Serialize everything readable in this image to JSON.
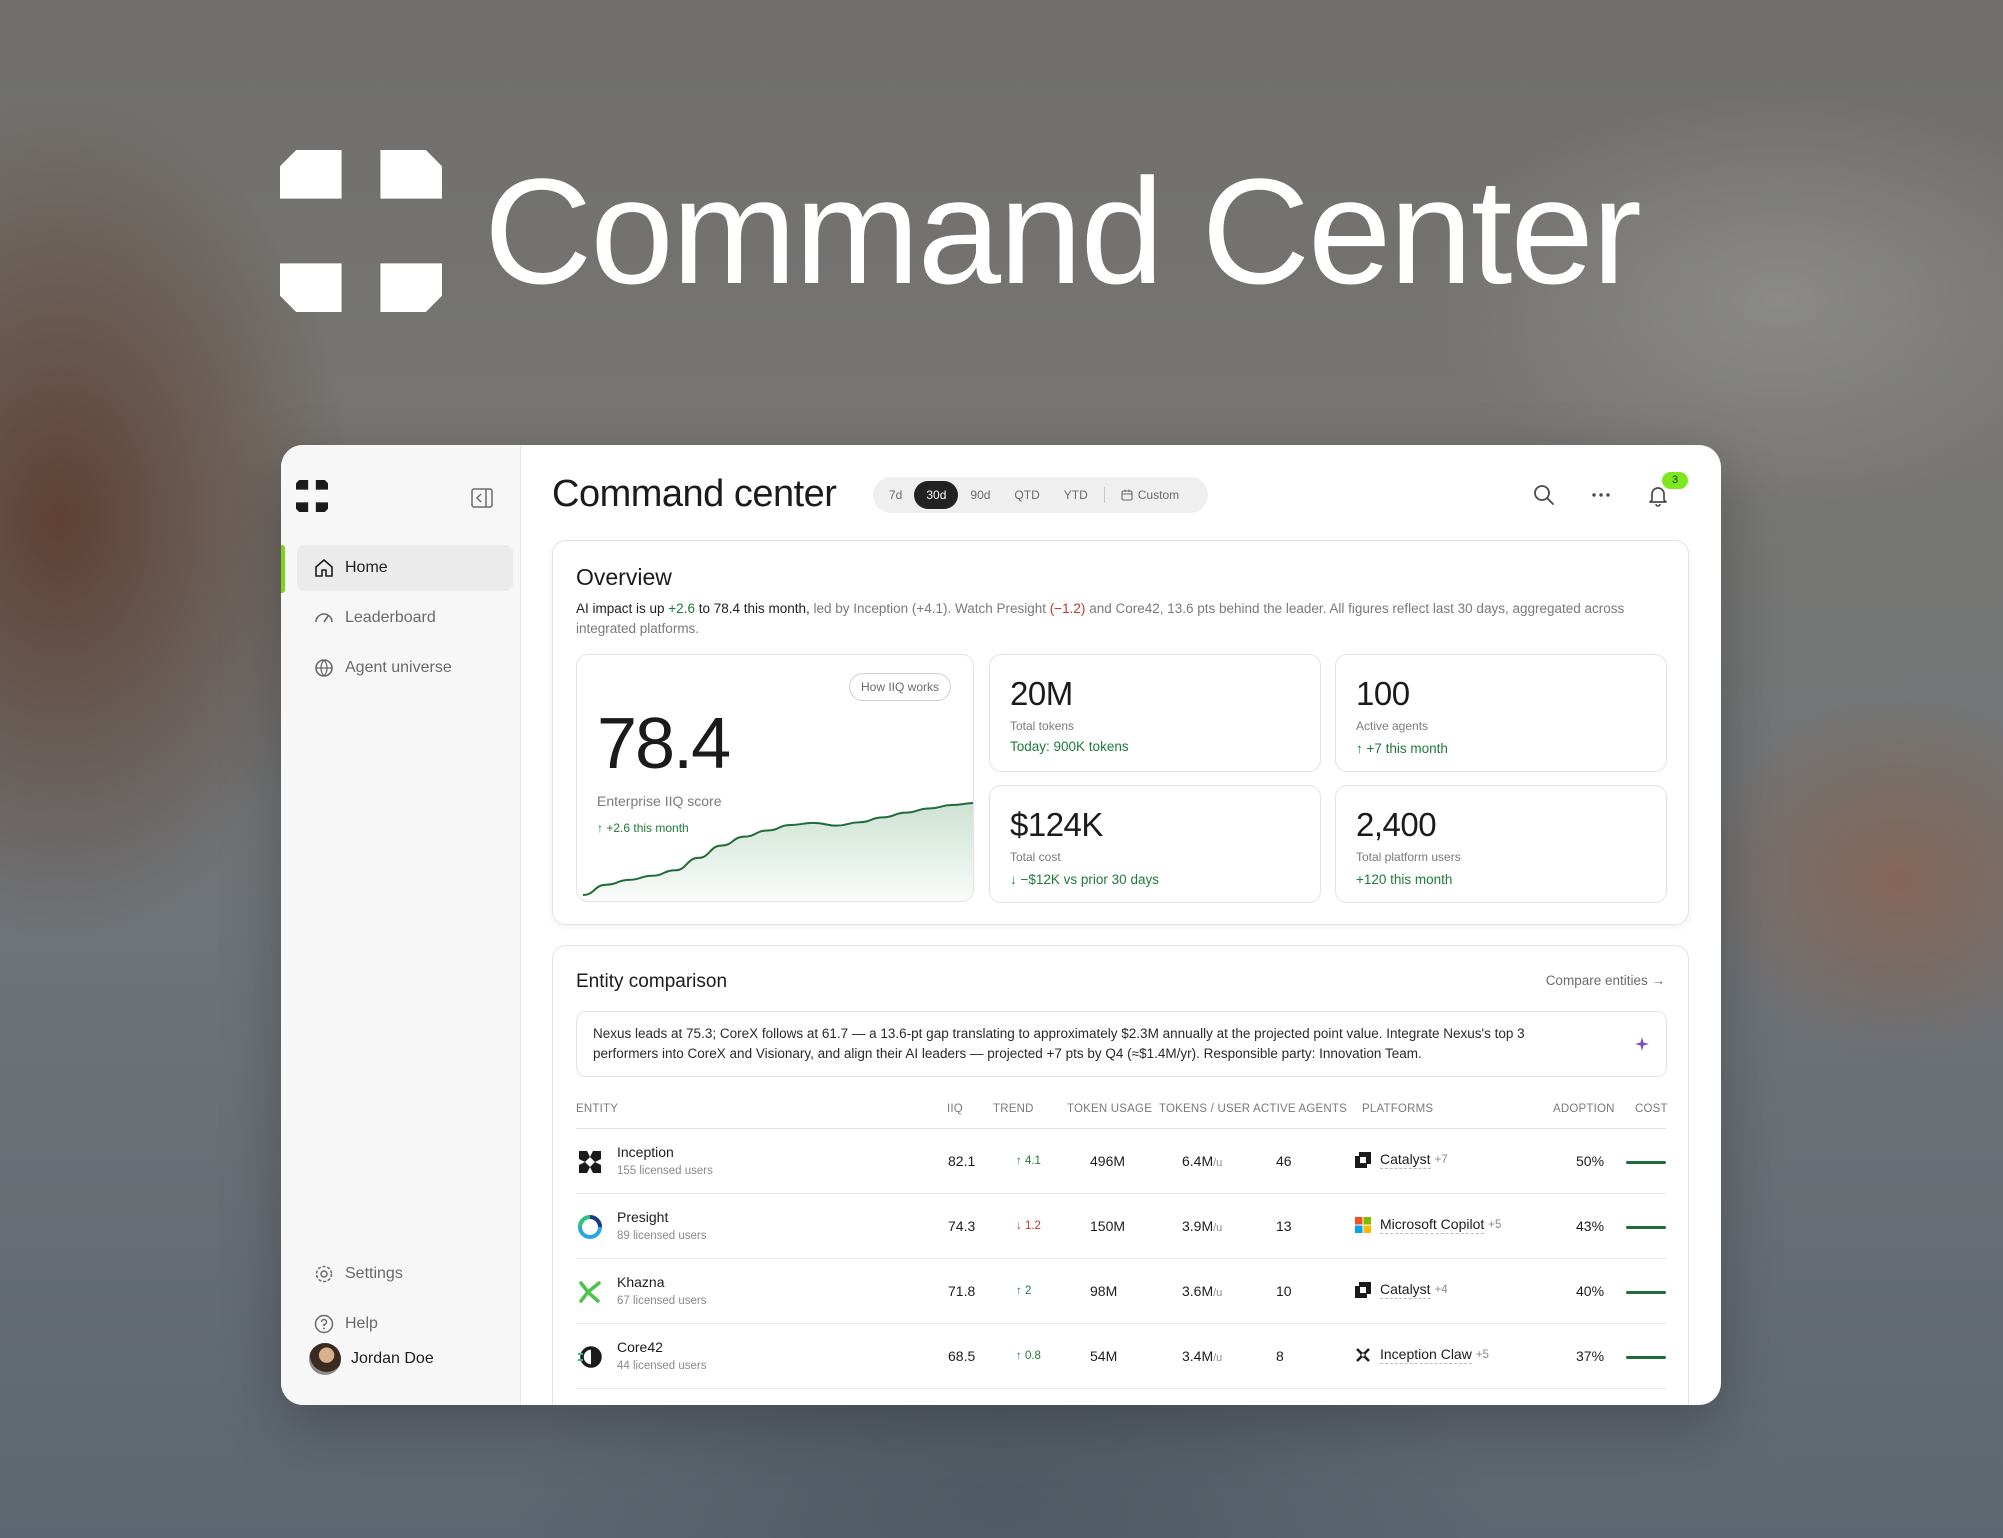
{
  "hero": {
    "title": "Command Center"
  },
  "sidebar": {
    "items": [
      {
        "label": "Home",
        "icon": "home-icon",
        "active": true
      },
      {
        "label": "Leaderboard",
        "icon": "gauge-icon",
        "active": false
      },
      {
        "label": "Agent universe",
        "icon": "globe-icon",
        "active": false
      }
    ],
    "bottom": [
      {
        "label": "Settings",
        "icon": "gear-icon"
      },
      {
        "label": "Help",
        "icon": "help-icon"
      }
    ],
    "user": {
      "name": "Jordan Doe"
    }
  },
  "header": {
    "title": "Command center",
    "ranges": [
      "7d",
      "30d",
      "90d",
      "QTD",
      "YTD"
    ],
    "selected_range": "30d",
    "custom_label": "Custom",
    "notifications": "3"
  },
  "overview": {
    "title": "Overview",
    "summary": {
      "p1": "AI impact is up ",
      "up": "+2.6",
      "p2": " to 78.4 this month,",
      "p3": " led by Inception (+4.1). Watch Presight ",
      "down": "(−1.2)",
      "p4": " and Core42, 13.6 pts behind the leader. All figures reflect last 30 days, aggregated across integrated platforms."
    },
    "score": {
      "button": "How IIQ works",
      "value": "78.4",
      "label": "Enterprise IIQ score",
      "delta": "↑ +2.6 this month",
      "trend": [
        65,
        66.5,
        67.2,
        67.8,
        68.6,
        70.4,
        72.2,
        73.5,
        74.4,
        75.2,
        75.5,
        75.1,
        75.6,
        76.3,
        77.0,
        77.6,
        78.1,
        78.4
      ]
    },
    "stats": [
      {
        "value": "20M",
        "label": "Total tokens",
        "sub": "Today: 900K tokens"
      },
      {
        "value": "100",
        "label": "Active agents",
        "sub": "↑ +7 this month"
      },
      {
        "value": "$124K",
        "label": "Total cost",
        "sub": "↓ −$12K vs prior 30 days"
      },
      {
        "value": "2,400",
        "label": "Total platform users",
        "sub": "+120 this month"
      }
    ]
  },
  "entity": {
    "title": "Entity comparison",
    "link": "Compare entities →",
    "insight": "Nexus leads at 75.3; CoreX follows at 61.7 — a 13.6-pt gap translating to approximately $2.3M annually at the projected point value. Integrate Nexus's top 3 performers into CoreX and Visionary, and align their AI leaders — projected +7 pts by Q4 (≈$1.4M/yr). Responsible party: Innovation Team.",
    "columns": [
      "ENTITY",
      "IIQ",
      "TREND",
      "TOKEN USAGE",
      "TOKENS / USER",
      "ACTIVE AGENTS",
      "PLATFORMS",
      "ADOPTION",
      "COST"
    ],
    "unit": "/u",
    "rows": [
      {
        "name": "Inception",
        "sub": "155 licensed users",
        "iiq": "82.1",
        "trend": "↑ 4.1",
        "tokens": "496M",
        "per_user": "6.4M",
        "agents": "46",
        "platform": "Catalyst",
        "more": "+7",
        "adoption": "50%"
      },
      {
        "name": "Presight",
        "sub": "89 licensed users",
        "iiq": "74.3",
        "trend": "↓ 1.2",
        "tokens": "150M",
        "per_user": "3.9M",
        "agents": "13",
        "platform": "Microsoft Copilot",
        "more": "+5",
        "adoption": "43%"
      },
      {
        "name": "Khazna",
        "sub": "67 licensed users",
        "iiq": "71.8",
        "trend": "↑ 2",
        "tokens": "98M",
        "per_user": "3.6M",
        "agents": "10",
        "platform": "Catalyst",
        "more": "+4",
        "adoption": "40%"
      },
      {
        "name": "Core42",
        "sub": "44 licensed users",
        "iiq": "68.5",
        "trend": "↑ 0.8",
        "tokens": "54M",
        "per_user": "3.4M",
        "agents": "8",
        "platform": "Inception Claw",
        "more": "+5",
        "adoption": "37%"
      }
    ]
  },
  "colors": {
    "accent": "#7ed321",
    "positive": "#1f7a3a",
    "negative": "#c0392b",
    "badge": "#7ee81f"
  }
}
